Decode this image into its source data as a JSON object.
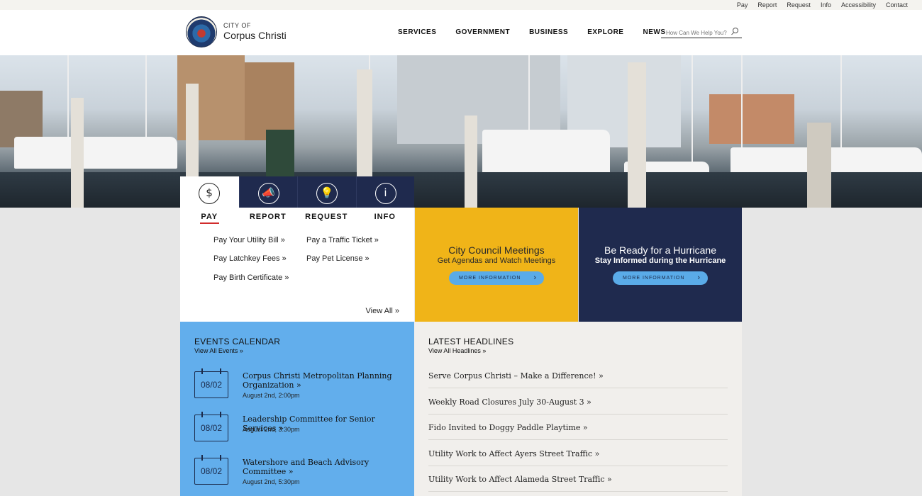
{
  "utility_nav": [
    "Pay",
    "Report",
    "Request",
    "Info",
    "Accessibility",
    "Contact"
  ],
  "logo": {
    "city": "CITY OF",
    "name": "Corpus Christi"
  },
  "main_nav": [
    "SERVICES",
    "GOVERNMENT",
    "BUSINESS",
    "EXPLORE",
    "NEWS"
  ],
  "search": {
    "placeholder": "How Can We Help You?"
  },
  "service_tabs": {
    "labels": [
      "PAY",
      "REPORT",
      "REQUEST",
      "INFO"
    ],
    "icons": [
      "dollar-icon",
      "megaphone-icon",
      "lightbulb-icon",
      "info-icon"
    ],
    "active": "PAY",
    "pay_links": [
      "Pay Your Utility Bill »",
      "Pay a Traffic Ticket »",
      "Pay Latchkey Fees »",
      "Pay Pet License »",
      "Pay Birth Certificate »"
    ],
    "view_all": "View All »"
  },
  "promos": [
    {
      "title": "City Council Meetings",
      "subtitle": "Get Agendas and Watch Meetings",
      "button": "MORE INFORMATION"
    },
    {
      "title": "Be Ready for a Hurricane",
      "subtitle": "Stay Informed during the Hurricane",
      "button": "MORE INFORMATION"
    }
  ],
  "events": {
    "title": "EVENTS CALENDAR",
    "view_all": "View All Events »",
    "items": [
      {
        "date": "08/02",
        "title": "Corpus Christi Metropolitan Planning Organization »",
        "time": "August 2nd, 2:00pm"
      },
      {
        "date": "08/02",
        "title": "Leadership Committee for Senior Services »",
        "time": "August 2nd, 3:30pm"
      },
      {
        "date": "08/02",
        "title": "Watershore and Beach Advisory Committee »",
        "time": "August 2nd, 5:30pm"
      }
    ]
  },
  "headlines": {
    "title": "LATEST HEADLINES",
    "view_all": "View All Headlines »",
    "items": [
      "Serve Corpus Christi – Make a Difference! »",
      "Weekly Road Closures July 30-August 3 »",
      "Fido Invited to Doggy Paddle Playtime »",
      "Utility Work to Affect Ayers Street Traffic »",
      "Utility Work to Affect Alameda Street Traffic »"
    ]
  },
  "colors": {
    "navy": "#1f2a4e",
    "yellow": "#f0b418",
    "events_blue": "#62aeec",
    "button_blue": "#5aabe8",
    "accent_red": "#d12c2c"
  }
}
